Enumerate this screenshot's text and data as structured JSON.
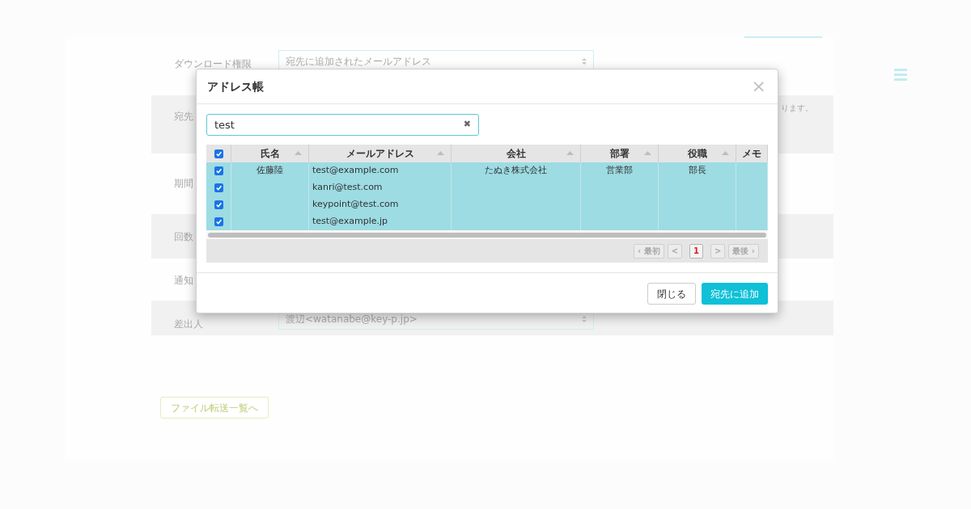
{
  "page": {
    "form_rows": [
      {
        "label": "ダウンロード権限",
        "field": "宛先に追加されたメールアドレス",
        "banded": false
      },
      {
        "label": "宛先",
        "hint": "ります。",
        "banded": true
      },
      {
        "label": "期間",
        "banded": false
      },
      {
        "label": "回数",
        "banded": true
      },
      {
        "label": "通知",
        "banded": false
      },
      {
        "label": "差出人",
        "field": "渡辺<watanabe@key-p.jp>",
        "banded": true
      }
    ],
    "back_button": "ファイル転送一覧へ"
  },
  "dialog": {
    "title": "アドレス帳",
    "close": "×",
    "search": {
      "value": "test",
      "clear": "✖"
    },
    "select_all": {
      "checked": true
    },
    "columns": [
      {
        "label": "氏名",
        "sortable": true
      },
      {
        "label": "メールアドレス",
        "sortable": true
      },
      {
        "label": "会社",
        "sortable": true
      },
      {
        "label": "部署",
        "sortable": true
      },
      {
        "label": "役職",
        "sortable": true
      },
      {
        "label": "メモ",
        "sortable": false
      }
    ],
    "rows": [
      {
        "checked": true,
        "name": "佐藤陸",
        "email": "test@example.com",
        "company": "たぬき株式会社",
        "department": "営業部",
        "position": "部長"
      },
      {
        "checked": true,
        "email": "kanri@test.com"
      },
      {
        "checked": true,
        "email": "keypoint@test.com"
      },
      {
        "checked": true,
        "email": "test@example.jp"
      }
    ],
    "pager": [
      {
        "label": "‹ 最初",
        "selected": false
      },
      {
        "label": "<",
        "selected": false
      },
      {
        "label": "1",
        "selected": true
      },
      {
        "label": ">",
        "selected": false
      },
      {
        "label": "最後 ›",
        "selected": false
      }
    ],
    "buttons": [
      {
        "label": "閉じる",
        "kind": "secondary"
      },
      {
        "label": "宛先に追加",
        "kind": "primary"
      }
    ]
  }
}
